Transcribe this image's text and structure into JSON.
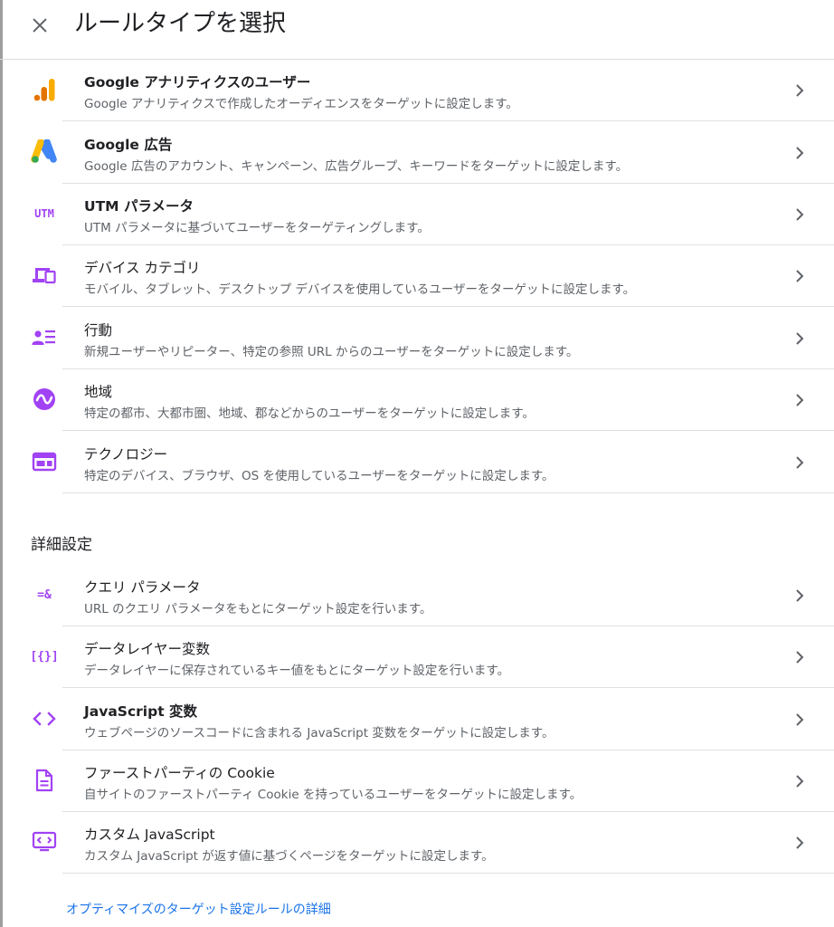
{
  "header": {
    "title": "ルールタイプを選択"
  },
  "rules": [
    {
      "title": "Google アナリティクスのユーザー",
      "description": "Google アナリティクスで作成したオーディエンスをターゲットに設定します。",
      "icon": "google-analytics-icon"
    },
    {
      "title": "Google 広告",
      "description": "Google 広告のアカウント、キャンペーン、広告グループ、キーワードをターゲットに設定します。",
      "icon": "google-ads-icon"
    },
    {
      "title": "UTM パラメータ",
      "description": "UTM パラメータに基づいてユーザーをターゲティングします。",
      "icon": "utm-icon",
      "icon_text": "UTM"
    },
    {
      "title": "デバイス カテゴリ",
      "description": "モバイル、タブレット、デスクトップ デバイスを使用しているユーザーをターゲットに設定します。",
      "icon": "devices-icon"
    },
    {
      "title": "行動",
      "description": "新規ユーザーやリピーター、特定の参照 URL からのユーザーをターゲットに設定します。",
      "icon": "behavior-icon"
    },
    {
      "title": "地域",
      "description": "特定の都市、大都市圏、地域、郡などからのユーザーをターゲットに設定します。",
      "icon": "geo-icon"
    },
    {
      "title": "テクノロジー",
      "description": "特定のデバイス、ブラウザ、OS を使用しているユーザーをターゲットに設定します。",
      "icon": "technology-icon"
    }
  ],
  "advanced": {
    "heading": "詳細設定",
    "rules": [
      {
        "title": "クエリ パラメータ",
        "description": "URL のクエリ パラメータをもとにターゲット設定を行います。",
        "icon": "query-param-icon",
        "icon_text": "=&"
      },
      {
        "title": "データレイヤー変数",
        "description": "データレイヤーに保存されているキー値をもとにターゲット設定を行います。",
        "icon": "data-layer-icon",
        "icon_text": "[{}]"
      },
      {
        "title": "JavaScript 変数",
        "description": "ウェブページのソースコードに含まれる JavaScript 変数をターゲットに設定します。",
        "icon": "code-icon"
      },
      {
        "title": "ファーストパーティの Cookie",
        "description": "自サイトのファーストパーティ Cookie を持っているユーザーをターゲットに設定します。",
        "icon": "cookie-doc-icon"
      },
      {
        "title": "カスタム JavaScript",
        "description": "カスタム JavaScript が返す値に基づくページをターゲットに設定します。",
        "icon": "custom-js-icon"
      }
    ]
  },
  "footer": {
    "link_text": "オプティマイズのターゲット設定ルールの詳細"
  },
  "colors": {
    "accent_purple": "#a142f4",
    "link_blue": "#1a73e8",
    "analytics_orange": "#f9ab00",
    "analytics_dark_orange": "#e37400",
    "ads_blue": "#4285f4",
    "ads_yellow": "#fbbc04",
    "ads_green": "#34a853"
  }
}
